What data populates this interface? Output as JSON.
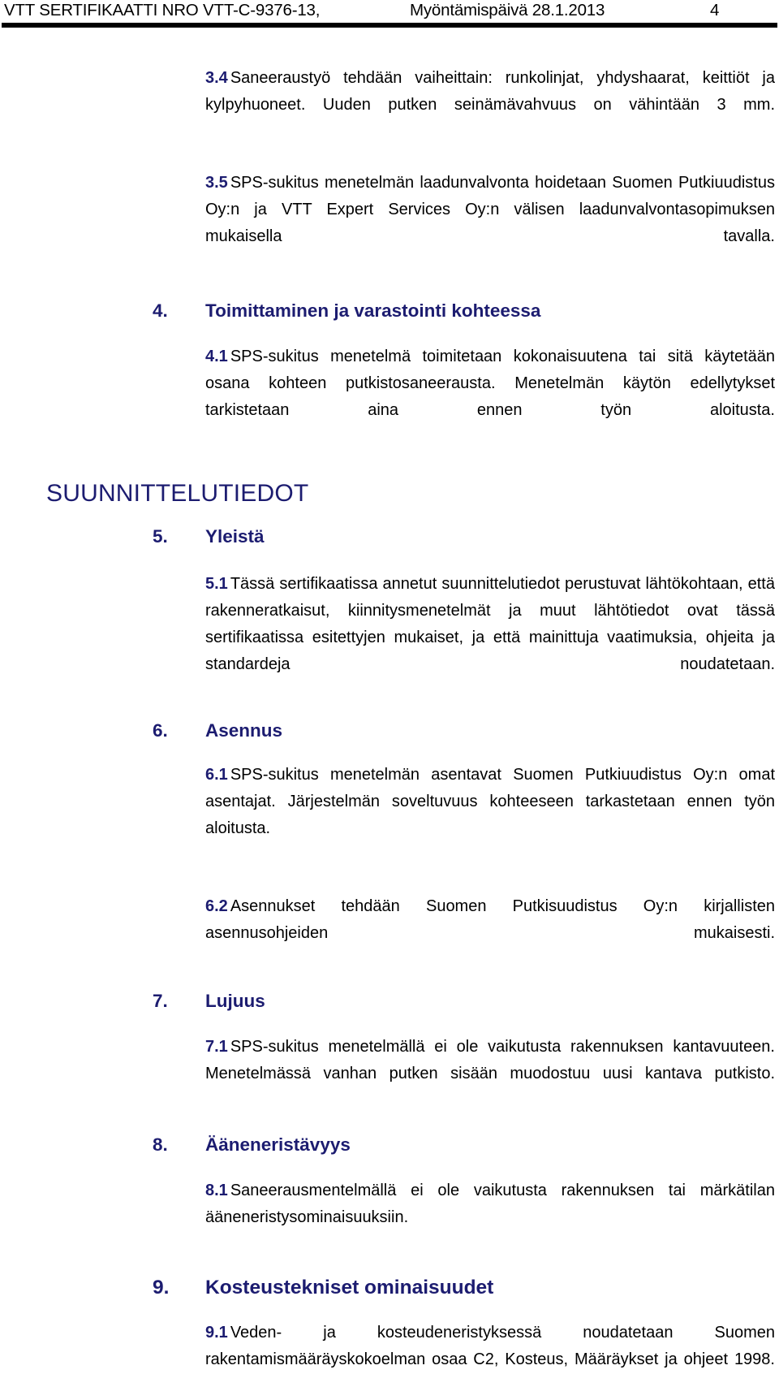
{
  "header": {
    "certificate_label": "VTT SERTIFIKAATTI NRO VTT-C-9376-13,",
    "issue_date_label": "Myöntämispäivä 28.1.2013",
    "page_number": "4"
  },
  "colors": {
    "heading_navy": "#1c1c70",
    "body_black": "#000000",
    "rule_black": "#000000",
    "page_background": "#ffffff"
  },
  "paragraphs": {
    "p34_num": "3.4",
    "p34_text": "Saneeraustyö tehdään vaiheittain: runkolinjat, yhdyshaarat, keittiöt ja kylpyhuoneet. Uuden putken seinämävahvuus on vähintään 3 mm.",
    "p35_num": "3.5",
    "p35_text": "SPS-sukitus menetelmän laadunvalvonta hoidetaan Suomen Putkiuudistus Oy:n ja VTT Expert Services Oy:n välisen laadunvalvontasopimuksen mukaisella tavalla.",
    "p41_num": "4.1",
    "p41_text": "SPS-sukitus menetelmä toimitetaan kokonaisuutena tai sitä käytetään osana kohteen putkistosaneerausta. Menetelmän käytön edellytykset tarkistetaan aina ennen työn aloitusta.",
    "p51_num": "5.1",
    "p51_text": "Tässä sertifikaatissa annetut suunnittelutiedot perustuvat lähtökohtaan, että rakenneratkaisut, kiinnitysmenetelmät ja muut lähtötiedot ovat tässä sertifikaatissa esitettyjen mukaiset, ja että mainittuja vaatimuksia, ohjeita ja standardeja noudatetaan.",
    "p61_num": "6.1",
    "p61_text": "SPS-sukitus menetelmän asentavat Suomen Putkiuudistus Oy:n omat asentajat. Järjestelmän soveltuvuus kohteeseen tarkastetaan ennen työn aloitusta.",
    "p62_num": "6.2",
    "p62_text": "Asennukset tehdään Suomen Putkisuudistus Oy:n kirjallisten asennusohjeiden mukaisesti.",
    "p71_num": "7.1",
    "p71_text": "SPS-sukitus menetelmällä ei ole vaikutusta rakennuksen kantavuuteen. Menetelmässä vanhan putken sisään muodostuu uusi kantava putkisto.",
    "p81_num": "8.1",
    "p81_text": "Saneerausmentelmällä ei ole vaikutusta rakennuksen tai märkätilan ääneneristysominaisuuksiin.",
    "p91_num": "9.1",
    "p91_text": "Veden- ja kosteudeneristyksessä noudatetaan Suomen rakentamismääräyskokoelman osaa C2, Kosteus, Määräykset ja ohjeet 1998."
  },
  "headings": {
    "part_suunnittelutiedot": "SUUNNITTELUTIEDOT",
    "s4_num": "4.",
    "s4_title": "Toimittaminen ja varastointi kohteessa",
    "s5_num": "5.",
    "s5_title": "Yleistä",
    "s6_num": "6.",
    "s6_title": "Asennus",
    "s7_num": "7.",
    "s7_title": "Lujuus",
    "s8_num": "8.",
    "s8_title": "Ääneneristävyys",
    "s9_num": "9.",
    "s9_title": "Kosteustekniset ominaisuudet"
  }
}
